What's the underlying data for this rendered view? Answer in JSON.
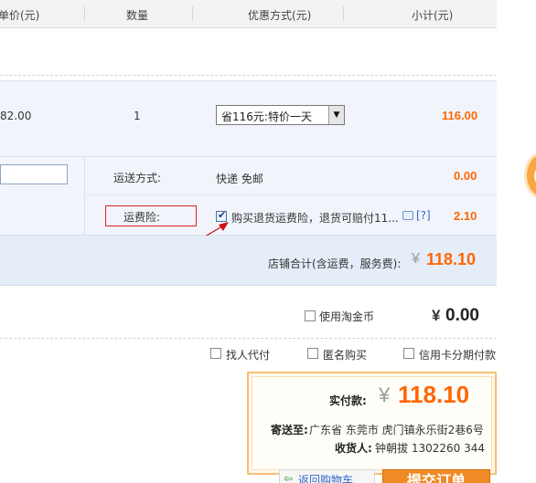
{
  "header": {
    "col_price": "单价(元)",
    "col_qty": "数量",
    "col_discount": "优惠方式(元)",
    "col_subtotal": "小计(元)"
  },
  "item": {
    "price": "82.00",
    "qty": "1",
    "discount_selected": "省116元:特价一天",
    "subtotal": "116.00"
  },
  "shipping": {
    "method_label": "运送方式:",
    "method_value": "快递 免邮",
    "method_fee": "0.00",
    "insurance_label": "运费险:",
    "insurance_text": "购买退货运费险，退货可赔付11...",
    "insurance_help": "[?]",
    "insurance_fee": "2.10",
    "insurance_checked": true
  },
  "store_total": {
    "label": "店铺合计(含运费，服务费):",
    "currency": "¥",
    "amount": "118.10"
  },
  "taojinbi": {
    "label": "使用淘金币",
    "currency": "¥",
    "amount": "0.00"
  },
  "options": {
    "proxy_pay": "找人代付",
    "anonymous": "匿名购买",
    "installment": "信用卡分期付款"
  },
  "payment": {
    "label": "实付款:",
    "currency": "¥",
    "amount": "118.10",
    "ship_to_label": "寄送至:",
    "ship_to_value": "广东省 东莞市 虎门镇永乐街2巷6号",
    "receiver_label": "收货人:",
    "receiver_value": "钟朝拔 1302260 344"
  },
  "actions": {
    "back_to_cart": "返回购物车",
    "submit_order": "提交订单"
  },
  "colors": {
    "accent": "#ff6600",
    "annotation": "#dd2222",
    "panel": "#f1f5fb"
  }
}
